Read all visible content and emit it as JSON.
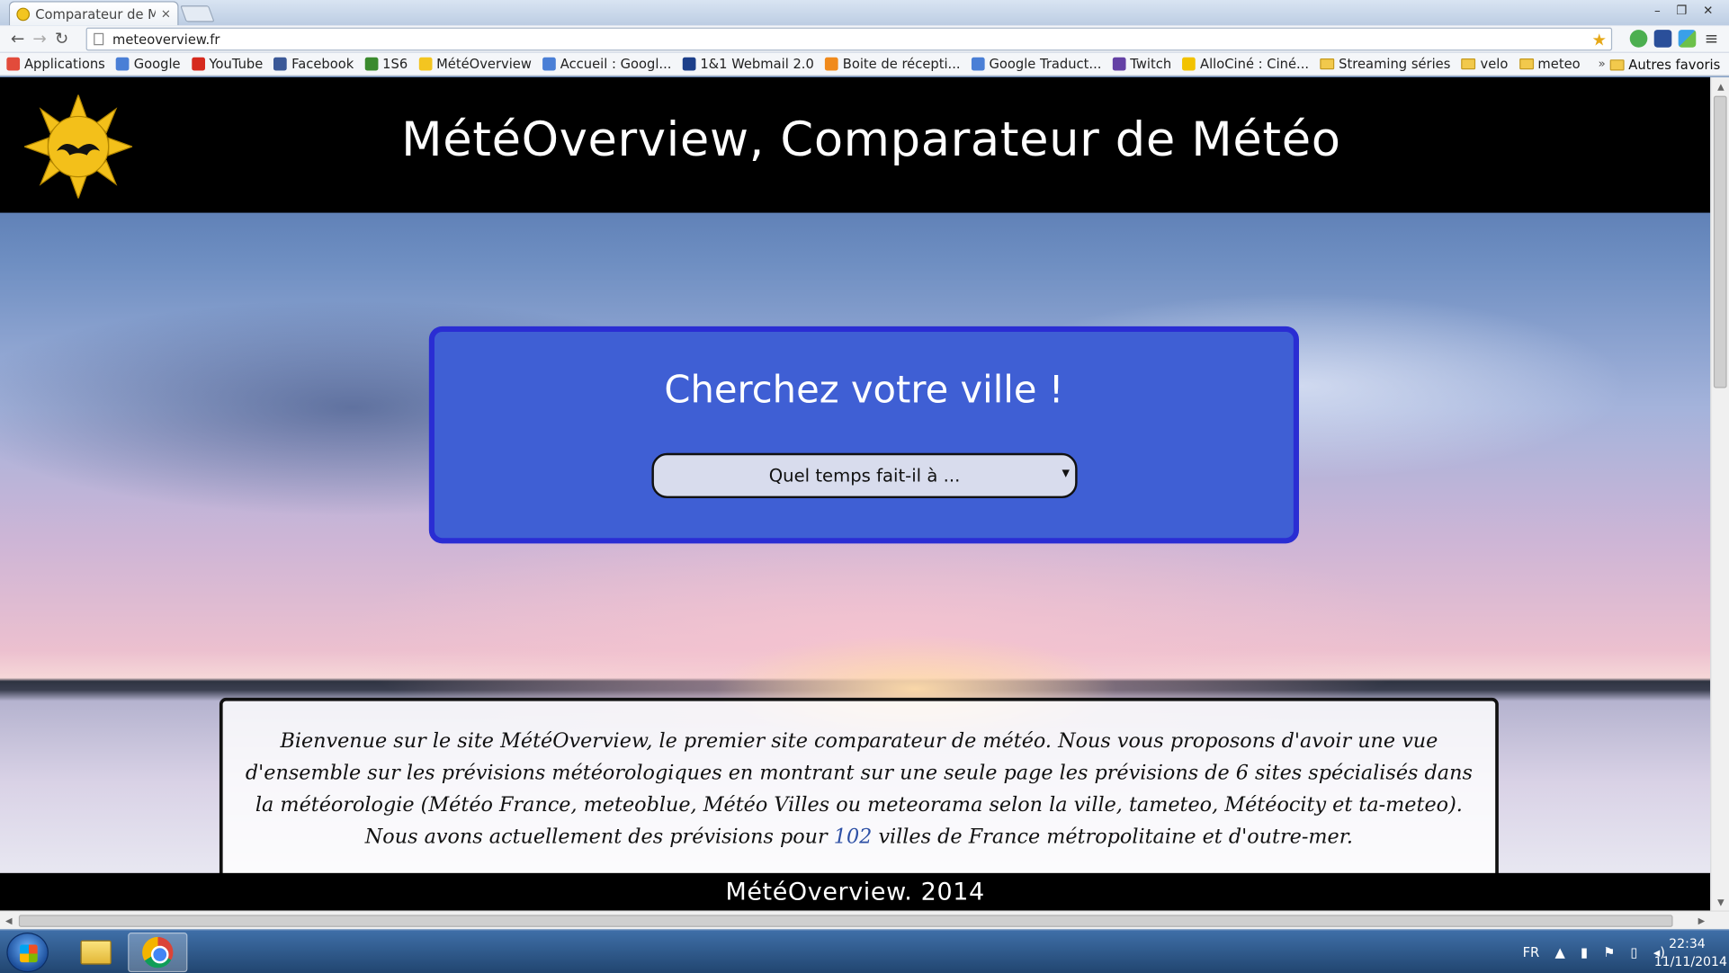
{
  "browser": {
    "tab_title": "Comparateur de Mé",
    "tab_close": "×",
    "url": "meteoverview.fr",
    "window_controls": {
      "minimize": "–",
      "restore": "❐",
      "close": "✕"
    }
  },
  "bookmarks": {
    "items": [
      {
        "label": "Applications",
        "icon_color": "#e24b3b"
      },
      {
        "label": "Google",
        "icon_color": "#4a7fd6"
      },
      {
        "label": "YouTube",
        "icon_color": "#d62b1f"
      },
      {
        "label": "Facebook",
        "icon_color": "#3b5998"
      },
      {
        "label": "1S6",
        "icon_color": "#3a8a2e"
      },
      {
        "label": "MétéOverview",
        "icon_color": "#f3c520"
      },
      {
        "label": "Accueil : Googl...",
        "icon_color": "#4a7fd6"
      },
      {
        "label": "1&1 Webmail 2.0",
        "icon_color": "#1c3f8a"
      },
      {
        "label": "Boite de récepti...",
        "icon_color": "#f08a1c"
      },
      {
        "label": "Google Traduct...",
        "icon_color": "#4a7fd6"
      },
      {
        "label": "Twitch",
        "icon_color": "#6441a5"
      },
      {
        "label": "AlloCiné : Ciné...",
        "icon_color": "#f2c200"
      },
      {
        "label": "Streaming séries",
        "icon_color": "#f2c94c",
        "folder": true
      },
      {
        "label": "velo",
        "icon_color": "#f2c94c",
        "folder": true
      },
      {
        "label": "meteo",
        "icon_color": "#f2c94c",
        "folder": true
      }
    ],
    "overflow": "»",
    "other": "Autres favoris"
  },
  "site": {
    "title": "MétéOverview, Comparateur de Météo",
    "search_title": "Cherchez votre ville !",
    "select_placeholder": "Quel temps fait-il à ...",
    "intro_before": "Bienvenue sur le site MétéOverview, le premier site comparateur de météo. Nous vous proposons d'avoir une vue d'ensemble sur les prévisions météorologiques en montrant sur une seule page les prévisions de 6 sites spécialisés dans la météorologie (Météo France, meteoblue, Météo Villes ou meteorama selon la ville, tameteo, Météocity et ta-meteo). Nous avons actuellement des prévisions pour ",
    "intro_count": "102",
    "intro_after": " villes de France métropolitaine et d'outre-mer.",
    "footer": "MétéOverview. 2014",
    "colors": {
      "header_bg": "#000000",
      "search_bg": "#3f5fd4",
      "search_border": "#2a2dd3",
      "count_link": "#2c4fa5"
    }
  },
  "taskbar": {
    "language": "FR",
    "time": "22:34",
    "date": "11/11/2014"
  }
}
